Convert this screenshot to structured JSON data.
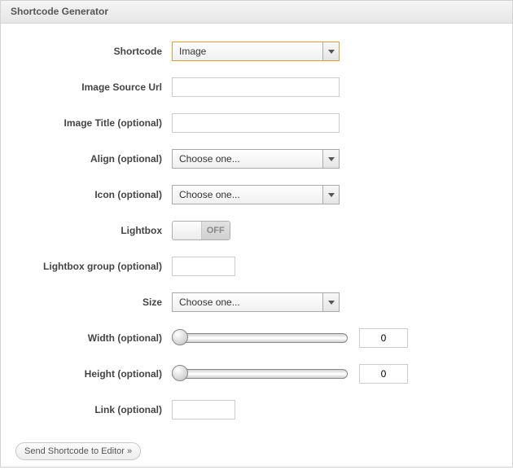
{
  "panel_title": "Shortcode Generator",
  "fields": {
    "shortcode": {
      "label": "Shortcode",
      "value": "Image"
    },
    "image_source": {
      "label": "Image Source Url",
      "value": ""
    },
    "image_title": {
      "label": "Image Title (optional)",
      "value": ""
    },
    "align": {
      "label": "Align (optional)",
      "value": "Choose one..."
    },
    "icon": {
      "label": "Icon (optional)",
      "value": "Choose one..."
    },
    "lightbox": {
      "label": "Lightbox",
      "state": "OFF"
    },
    "lightbox_group": {
      "label": "Lightbox group (optional)",
      "value": ""
    },
    "size": {
      "label": "Size",
      "value": "Choose one..."
    },
    "width": {
      "label": "Width (optional)",
      "value": "0"
    },
    "height": {
      "label": "Height (optional)",
      "value": "0"
    },
    "link": {
      "label": "Link (optional)",
      "value": ""
    }
  },
  "send_button": "Send Shortcode to Editor »"
}
